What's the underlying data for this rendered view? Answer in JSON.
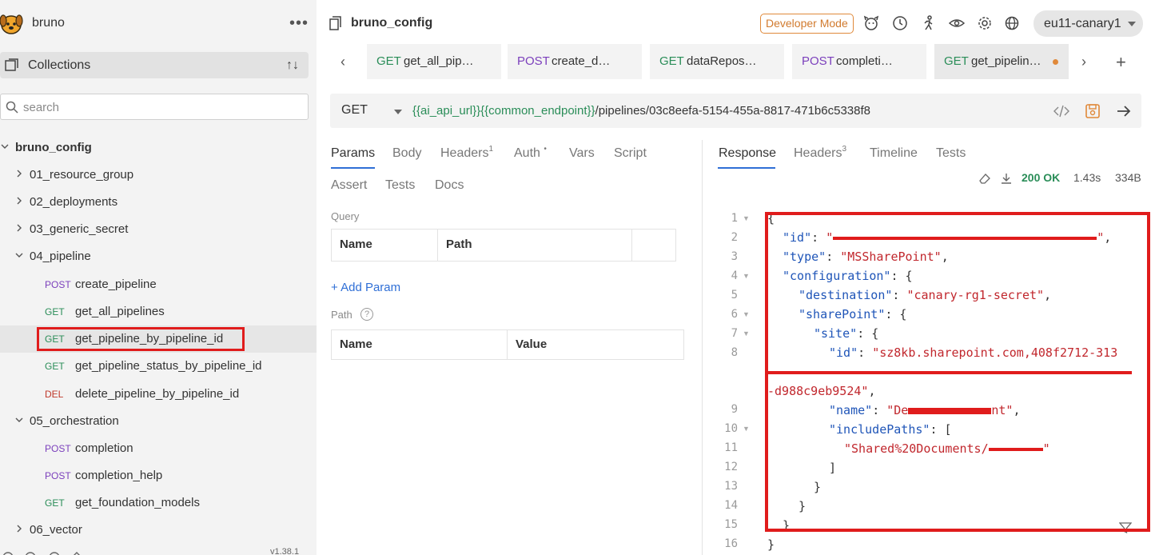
{
  "sidebar": {
    "app_name": "bruno",
    "collections_label": "Collections",
    "search_placeholder": "search",
    "collection_name": "bruno_config",
    "folders": [
      {
        "label": "01_resource_group"
      },
      {
        "label": "02_deployments"
      },
      {
        "label": "03_generic_secret"
      },
      {
        "label": "04_pipeline"
      },
      {
        "label": "05_orchestration"
      },
      {
        "label": "06_vector"
      }
    ],
    "pipeline_items": [
      {
        "method": "POST",
        "label": "create_pipeline"
      },
      {
        "method": "GET",
        "label": "get_all_pipelines"
      },
      {
        "method": "GET",
        "label": "get_pipeline_by_pipeline_id"
      },
      {
        "method": "GET",
        "label": "get_pipeline_status_by_pipeline_id"
      },
      {
        "method": "DEL",
        "label": "delete_pipeline_by_pipeline_id"
      }
    ],
    "orchestration_items": [
      {
        "method": "POST",
        "label": "completion"
      },
      {
        "method": "POST",
        "label": "completion_help"
      },
      {
        "method": "GET",
        "label": "get_foundation_models"
      }
    ],
    "version": "v1.38.1"
  },
  "header": {
    "collection_title": "bruno_config",
    "developer_mode": "Developer Mode",
    "environment": "eu11-canary1"
  },
  "tabs": [
    {
      "method": "GET",
      "name": "get_all_pip…"
    },
    {
      "method": "POST",
      "name": "create_d…"
    },
    {
      "method": "GET",
      "name": "dataRepos…"
    },
    {
      "method": "POST",
      "name": "completi…"
    },
    {
      "method": "GET",
      "name": "get_pipelin…"
    }
  ],
  "request": {
    "method": "GET",
    "url_var1": "{{ai_api_url}}",
    "url_var2": "{{common_endpoint}}",
    "url_path": "/pipelines/03c8eefa-5154-455a-8817-471b6c5338f8",
    "tabs": {
      "params": "Params",
      "body": "Body",
      "headers": "Headers",
      "headers_count": "1",
      "auth": "Auth",
      "auth_mark": "•",
      "vars": "Vars",
      "script": "Script",
      "assert": "Assert",
      "tests": "Tests",
      "docs": "Docs"
    },
    "query_label": "Query",
    "query_cols": [
      "Name",
      "Path"
    ],
    "add_param": "+ Add Param",
    "path_label": "Path",
    "path_cols": [
      "Name",
      "Value"
    ]
  },
  "response": {
    "tabs": {
      "response": "Response",
      "headers": "Headers",
      "headers_count": "3",
      "timeline": "Timeline",
      "tests": "Tests"
    },
    "status": "200 OK",
    "time": "1.43s",
    "size": "334B",
    "line_numbers": [
      "1",
      "2",
      "3",
      "4",
      "5",
      "6",
      "7",
      "8",
      "",
      "9",
      "10",
      "11",
      "12",
      "13",
      "14",
      "15",
      "16"
    ],
    "lines": {
      "l1": "{",
      "l2_key": "\"id\"",
      "l3_key": "\"type\"",
      "l3_val": "\"MSSharePoint\"",
      "l4_key": "\"configuration\"",
      "l5_key": "\"destination\"",
      "l5_val": "\"canary-rg1-secret\"",
      "l6_key": "\"sharePoint\"",
      "l7_key": "\"site\"",
      "l8_key": "\"id\"",
      "l8_val": "\"sz8kb.sharepoint.com,408f2712-313",
      "l8b_val": "-d988c9eb9524\"",
      "l9_key": "\"name\"",
      "l9_val_a": "\"De",
      "l9_val_b": "nt\"",
      "l10_key": "\"includePaths\"",
      "l11_val": "\"Shared%20Documents/",
      "l16": "}"
    }
  }
}
